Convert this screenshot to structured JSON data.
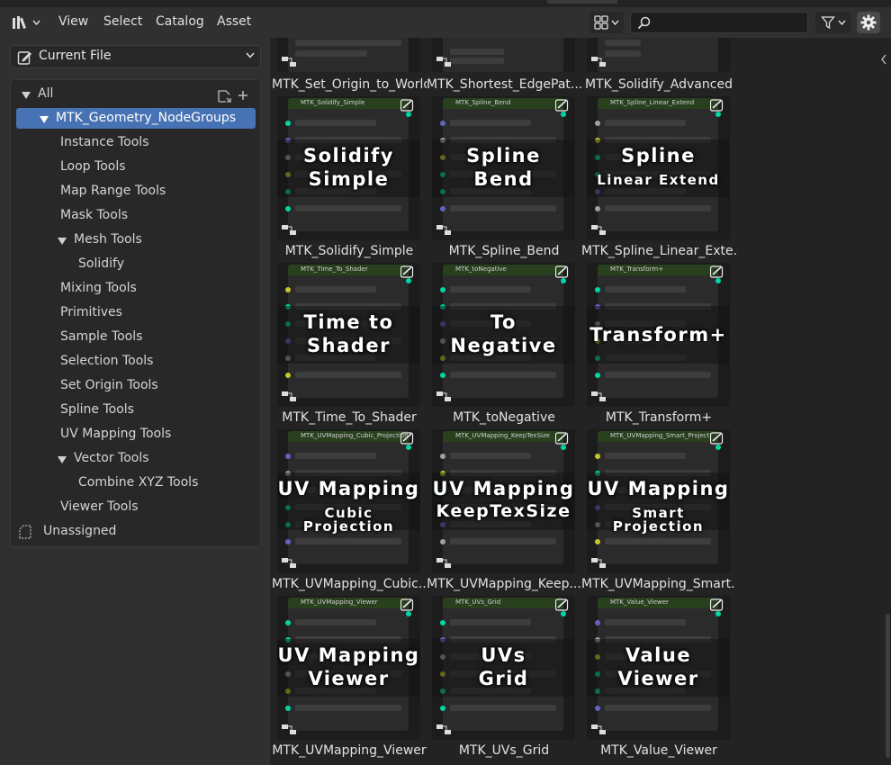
{
  "menubar": {
    "menus": [
      "View",
      "Select",
      "Catalog",
      "Asset"
    ],
    "search_placeholder": ""
  },
  "library": {
    "selected": "Current File"
  },
  "tree": [
    {
      "label": "All",
      "level": 0,
      "expanded": true
    },
    {
      "label": "MTK_Geometry_NodeGroups",
      "level": 1,
      "expanded": true,
      "selected": true
    },
    {
      "label": "Instance Tools",
      "level": 2
    },
    {
      "label": "Loop Tools",
      "level": 2
    },
    {
      "label": "Map Range Tools",
      "level": 2
    },
    {
      "label": "Mask Tools",
      "level": 2
    },
    {
      "label": "Mesh Tools",
      "level": 2,
      "expanded": true
    },
    {
      "label": "Solidify",
      "level": 3
    },
    {
      "label": "Mixing Tools",
      "level": 2
    },
    {
      "label": "Primitives",
      "level": 2
    },
    {
      "label": "Sample Tools",
      "level": 2
    },
    {
      "label": "Selection Tools",
      "level": 2
    },
    {
      "label": "Set Origin Tools",
      "level": 2
    },
    {
      "label": "Spline Tools",
      "level": 2
    },
    {
      "label": "UV Mapping Tools",
      "level": 2
    },
    {
      "label": "Vector Tools",
      "level": 2,
      "expanded": true
    },
    {
      "label": "Combine XYZ Tools",
      "level": 3
    },
    {
      "label": "Viewer Tools",
      "level": 2
    },
    {
      "label": "Unassigned",
      "level": 0
    }
  ],
  "assets_top_row": [
    {
      "caption": "MTK_Set_Origin_to_World"
    },
    {
      "caption": "MTK_Shortest_EdgePat..."
    },
    {
      "caption": "MTK_Solidify_Advanced"
    }
  ],
  "assets": [
    {
      "caption": "MTK_Solidify_Simple",
      "big": [
        "Solidify",
        "Simple"
      ],
      "node_title": "MTK_Solidify_Simple"
    },
    {
      "caption": "MTK_Spline_Bend",
      "big": [
        "Spline",
        "Bend"
      ],
      "node_title": "MTK_Spline_Bend"
    },
    {
      "caption": "MTK_Spline_Linear_Exte...",
      "big": [
        "Spline",
        "Linear Extend"
      ],
      "node_title": "MTK_Spline_Linear_Extend"
    },
    {
      "caption": "MTK_Time_To_Shader",
      "big": [
        "Time to",
        "Shader"
      ],
      "node_title": "MTK_Time_To_Shader"
    },
    {
      "caption": "MTK_toNegative",
      "big": [
        "To",
        "Negative"
      ],
      "node_title": "MTK_toNegative"
    },
    {
      "caption": "MTK_Transform+",
      "big": [
        "Transform+"
      ],
      "node_title": "MTK_Transform+"
    },
    {
      "caption": "MTK_UVMapping_Cubic...",
      "big": [
        "UV Mapping",
        "Cubic Projection"
      ],
      "node_title": "MTK_UVMapping_Cubic_Projection"
    },
    {
      "caption": "MTK_UVMapping_Keep...",
      "big": [
        "UV Mapping",
        "KeepTexSize"
      ],
      "node_title": "MTK_UVMapping_KeepTexSize"
    },
    {
      "caption": "MTK_UVMapping_Smart...",
      "big": [
        "UV Mapping",
        "Smart Projection"
      ],
      "node_title": "MTK_UVMapping_Smart_Project"
    },
    {
      "caption": "MTK_UVMapping_Viewer",
      "big": [
        "UV Mapping",
        "Viewer"
      ],
      "node_title": "MTK_UVMapping_Viewer"
    },
    {
      "caption": "MTK_UVs_Grid",
      "big": [
        "UVs",
        "Grid"
      ],
      "node_title": "MTK_UVs_Grid"
    },
    {
      "caption": "MTK_Value_Viewer",
      "big": [
        "Value",
        "Viewer"
      ],
      "node_title": "MTK_Value_Viewer"
    }
  ]
}
